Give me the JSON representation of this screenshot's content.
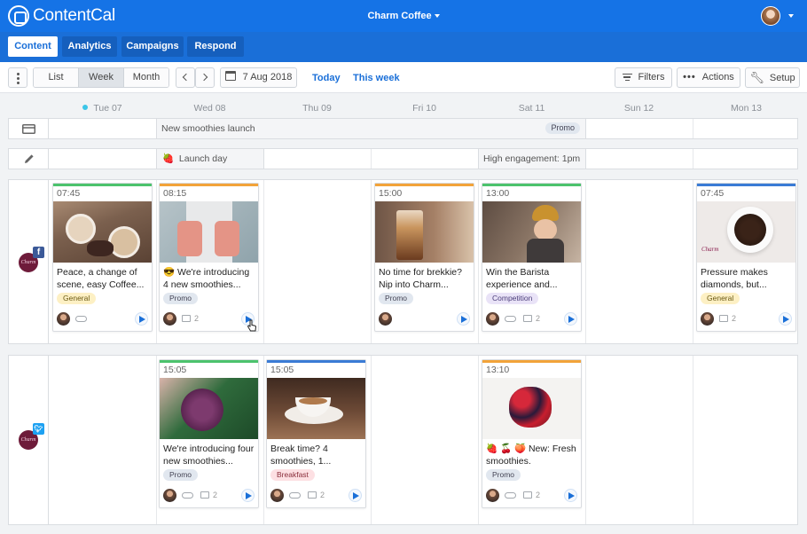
{
  "app": {
    "name": "ContentCal",
    "account": "Charm Coffee"
  },
  "nav": {
    "tabs": [
      {
        "label": "Content"
      },
      {
        "label": "Analytics"
      },
      {
        "label": "Campaigns"
      },
      {
        "label": "Respond"
      }
    ]
  },
  "toolbar": {
    "views": [
      "List",
      "Week",
      "Month"
    ],
    "date": "7 Aug 2018",
    "today": "Today",
    "this_week": "This week",
    "filters": "Filters",
    "actions": "Actions",
    "setup": "Setup"
  },
  "days": [
    "Tue 07",
    "Wed 08",
    "Thu 09",
    "Fri 10",
    "Sat 11",
    "Sun 12",
    "Mon 13"
  ],
  "campaign_row": {
    "label": "New smoothies launch",
    "badge": "Promo"
  },
  "notes_row": {
    "launch": "Launch day",
    "engagement": "High engagement: 1pm"
  },
  "channel_avatar_text": "Charm",
  "facebook_posts": [
    {
      "time": "07:45",
      "caption": "Peace, a change of scene, easy Coffee...",
      "tag": "General",
      "comments": ""
    },
    {
      "time": "08:15",
      "caption": "😎 We're introducing 4 new smoothies...",
      "tag": "Promo",
      "comments": "2"
    },
    {
      "time": "15:00",
      "caption": "No time for brekkie? Nip into Charm...",
      "tag": "Promo",
      "comments": ""
    },
    {
      "time": "13:00",
      "caption": "Win the Barista experience and...",
      "tag": "Competition",
      "comments": "2"
    },
    {
      "time": "07:45",
      "caption": "Pressure makes diamonds, but...",
      "tag": "General",
      "comments": "2"
    }
  ],
  "twitter_posts": [
    {
      "time": "15:05",
      "caption": "We're introducing four new smoothies...",
      "tag": "Promo",
      "comments": "2"
    },
    {
      "time": "15:05",
      "caption": "Break time? 4 smoothies, 1...",
      "tag": "Breakfast",
      "comments": "2"
    },
    {
      "time": "13:10",
      "caption": "🍓 🍒 🍑 New: Fresh smoothies.",
      "tag": "Promo",
      "comments": "2"
    }
  ],
  "colors": {
    "brand": "#1573e6",
    "tag_general": "#fdf0c4",
    "tag_promo": "#e1e7ef",
    "tag_competition": "#e9e3f7",
    "tag_breakfast": "#fde0e3",
    "facebook": "#3b5998",
    "twitter": "#1da1f2"
  }
}
